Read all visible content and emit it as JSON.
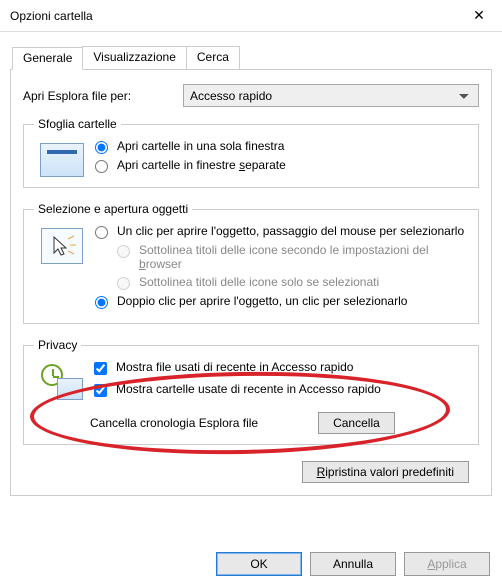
{
  "window": {
    "title": "Opzioni cartella",
    "close": "✕"
  },
  "tabs": {
    "general": "Generale",
    "view": "Visualizzazione",
    "search": "Cerca"
  },
  "open": {
    "label": "Apri Esplora file per:",
    "selected": "Accesso rapido"
  },
  "browse": {
    "legend": "Sfoglia cartelle",
    "opt1": "Apri cartelle in una sola finestra",
    "opt2_pre": "Apri cartelle in finestre ",
    "opt2_u": "s",
    "opt2_post": "eparate"
  },
  "click": {
    "legend": "Selezione e apertura oggetti",
    "opt1": "Un clic per aprire l'oggetto, passaggio del mouse per selezionarlo",
    "sub1_pre": "Sottolinea titoli delle icone secondo le impostazioni del ",
    "sub1_u": "b",
    "sub1_post": "rowser",
    "sub2": "Sottolinea titoli delle icone solo se selezionati",
    "opt2": "Doppio clic per aprire l'oggetto, un clic per selezionarlo"
  },
  "privacy": {
    "legend": "Privacy",
    "chk1": "Mostra file usati di recente in Accesso rapido",
    "chk2": "Mostra cartelle usate di recente in Accesso rapido",
    "clear_label": "Cancella cronologia Esplora file",
    "clear_btn": "Cancella"
  },
  "restore": {
    "pre": "",
    "u": "R",
    "post": "ipristina valori predefiniti"
  },
  "footer": {
    "ok": "OK",
    "cancel": "Annulla",
    "apply_u": "A",
    "apply_post": "pplica"
  }
}
